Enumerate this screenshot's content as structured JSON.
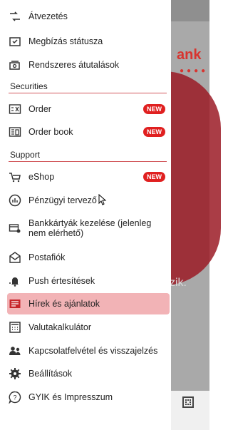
{
  "background": {
    "brand_fragment": "ank",
    "text_fragment": "zik."
  },
  "menu": {
    "items_top": [
      {
        "label": "Átvezetés",
        "icon": "transfer-icon"
      },
      {
        "label": "Megbízás státusza",
        "icon": "order-status-icon"
      },
      {
        "label": "Rendszeres átutalások",
        "icon": "recurring-transfer-icon"
      }
    ],
    "securities": {
      "title": "Securities",
      "items": [
        {
          "label": "Order",
          "badge": "NEW",
          "icon": "order-icon"
        },
        {
          "label": "Order book",
          "badge": "NEW",
          "icon": "order-book-icon"
        }
      ]
    },
    "support": {
      "title": "Support",
      "items": [
        {
          "label": "eShop",
          "badge": "NEW",
          "icon": "cart-icon"
        },
        {
          "label": "Pénzügyi tervező",
          "icon": "finance-planner-icon"
        },
        {
          "label": "Bankkártyák kezelése (jelenleg nem elérhető)",
          "icon": "card-settings-icon"
        },
        {
          "label": "Postafiók",
          "icon": "mailbox-icon"
        },
        {
          "label": "Push értesítések",
          "icon": "push-notification-icon"
        },
        {
          "label": "Hírek és ajánlatok",
          "icon": "news-icon",
          "active": true
        },
        {
          "label": "Valutakalkulátor",
          "icon": "calculator-icon"
        },
        {
          "label": "Kapcsolatfelvétel és visszajelzés",
          "icon": "contact-icon"
        },
        {
          "label": "Beállítások",
          "icon": "settings-icon"
        },
        {
          "label": "GYIK és Impresszum",
          "icon": "faq-icon"
        }
      ]
    }
  },
  "colors": {
    "accent": "#e02020",
    "active_bg": "#f2b3b6"
  }
}
